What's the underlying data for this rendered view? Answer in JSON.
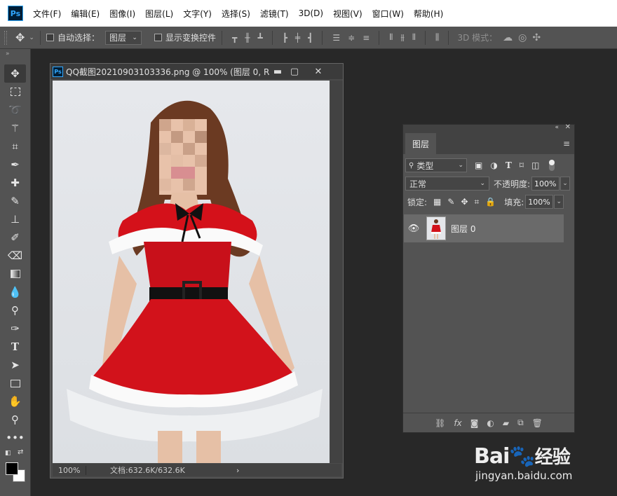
{
  "menubar": {
    "app_icon": "Ps",
    "items": [
      "文件(F)",
      "编辑(E)",
      "图像(I)",
      "图层(L)",
      "文字(Y)",
      "选择(S)",
      "滤镜(T)",
      "3D(D)",
      "视图(V)",
      "窗口(W)",
      "帮助(H)"
    ]
  },
  "options": {
    "tool_icon": "move-icon",
    "auto_select_label": "自动选择：",
    "auto_select_target": "图层",
    "show_transform_label": "显示变换控件",
    "mode_3d_label": "3D 模式："
  },
  "toolbar": {
    "tools": [
      "move",
      "marquee",
      "lasso",
      "magic-wand",
      "crop",
      "eyedropper",
      "healing-brush",
      "brush",
      "clone-stamp",
      "history-brush",
      "eraser",
      "gradient",
      "blur",
      "dodge",
      "pen",
      "type",
      "path-selection",
      "rectangle",
      "hand",
      "zoom",
      "more"
    ],
    "foreground_color": "#000000",
    "background_color": "#ffffff"
  },
  "document": {
    "icon": "Ps",
    "title": "QQ截图20210903103336.png @ 100% (图层 0, R...",
    "zoom": "100%",
    "doc_info": "文档:632.6K/632.6K"
  },
  "layers_panel": {
    "tab_label": "图层",
    "filter_label": "类型",
    "blend_mode": "正常",
    "opacity_label": "不透明度:",
    "opacity_value": "100%",
    "lock_label": "锁定:",
    "fill_label": "填充:",
    "fill_value": "100%",
    "layers": [
      {
        "name": "图层 0",
        "visible": true
      }
    ]
  },
  "watermark": {
    "logo_text": "Bai",
    "logo_suffix": "经验",
    "url": "jingyan.baidu.com"
  }
}
